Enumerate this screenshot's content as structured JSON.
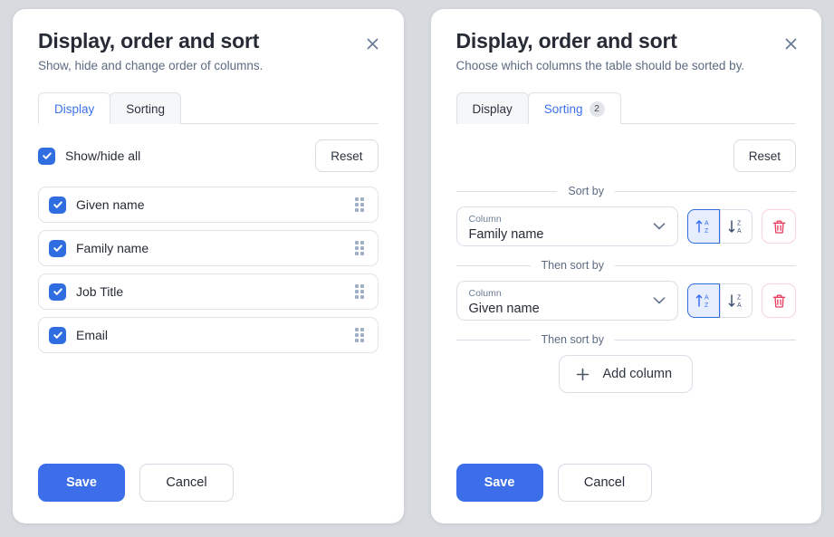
{
  "left_panel": {
    "title": "Display, order and sort",
    "subtitle": "Show, hide and change order of columns.",
    "close_icon": "close-icon",
    "tabs": [
      {
        "label": "Display",
        "active": true,
        "badge": null
      },
      {
        "label": "Sorting",
        "active": false,
        "badge": null
      }
    ],
    "reset_label": "Reset",
    "show_hide_all": {
      "label": "Show/hide all",
      "checked": true
    },
    "columns": [
      {
        "label": "Given name",
        "checked": true
      },
      {
        "label": "Family name",
        "checked": true
      },
      {
        "label": "Job Title",
        "checked": true
      },
      {
        "label": "Email",
        "checked": true
      }
    ],
    "save_label": "Save",
    "cancel_label": "Cancel"
  },
  "right_panel": {
    "title": "Display, order and sort",
    "subtitle": "Choose which columns the table should be sorted by.",
    "close_icon": "close-icon",
    "tabs": [
      {
        "label": "Display",
        "active": false,
        "badge": null
      },
      {
        "label": "Sorting",
        "active": true,
        "badge": "2"
      }
    ],
    "reset_label": "Reset",
    "sort_rules": [
      {
        "legend": "Sort by",
        "field_label": "Column",
        "field_value": "Family name",
        "direction": "asc",
        "asc_icon": "sort-ascending-icon",
        "desc_icon": "sort-descending-icon",
        "delete_icon": "trash-icon"
      },
      {
        "legend": "Then sort by",
        "field_label": "Column",
        "field_value": "Given name",
        "direction": "asc",
        "asc_icon": "sort-ascending-icon",
        "desc_icon": "sort-descending-icon",
        "delete_icon": "trash-icon"
      }
    ],
    "add_legend": "Then sort by",
    "add_column_label": "Add column",
    "save_label": "Save",
    "cancel_label": "Cancel"
  },
  "colors": {
    "accent_blue": "#3b6ee8",
    "checkbox_blue": "#2f6de0",
    "danger_red": "#ea3c5e",
    "page_background": "#d7dade",
    "panel_background": "#ffffff",
    "text_primary": "#272b35",
    "text_muted": "#5d6b82"
  }
}
